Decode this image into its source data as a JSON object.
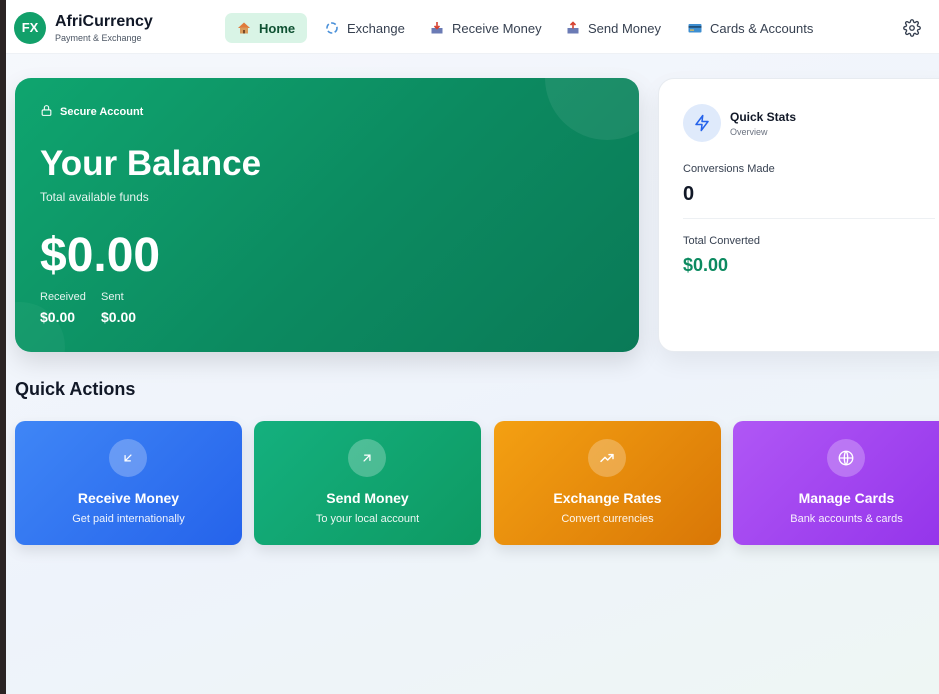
{
  "brand": {
    "logo": "FX",
    "name": "AfriCurrency",
    "tagline": "Payment & Exchange"
  },
  "nav": [
    {
      "label": "Home",
      "icon": "house-icon",
      "active": true
    },
    {
      "label": "Exchange",
      "icon": "exchange-icon",
      "active": false
    },
    {
      "label": "Receive Money",
      "icon": "receive-inbox-icon",
      "active": false
    },
    {
      "label": "Send Money",
      "icon": "send-outbox-icon",
      "active": false
    },
    {
      "label": "Cards & Accounts",
      "icon": "credit-card-icon",
      "active": false
    }
  ],
  "balance": {
    "badge": "Secure Account",
    "title": "Your Balance",
    "subtitle": "Total available funds",
    "amount": "$0.00",
    "received_label": "Received",
    "received_value": "$0.00",
    "sent_label": "Sent",
    "sent_value": "$0.00"
  },
  "quick_stats": {
    "title": "Quick Stats",
    "subtitle": "Overview",
    "conversions_label": "Conversions Made",
    "conversions_value": "0",
    "converted_label": "Total Converted",
    "converted_value": "$0.00"
  },
  "quick_actions": {
    "heading": "Quick Actions",
    "items": [
      {
        "title": "Receive Money",
        "subtitle": "Get paid internationally",
        "icon": "arrow-down-left-icon",
        "color": "#3b82f6"
      },
      {
        "title": "Send Money",
        "subtitle": "To your local account",
        "icon": "arrow-up-right-icon",
        "color": "#10b981"
      },
      {
        "title": "Exchange Rates",
        "subtitle": "Convert currencies",
        "icon": "trending-up-icon",
        "color": "#f59e0b"
      },
      {
        "title": "Manage Cards",
        "subtitle": "Bank accounts & cards",
        "icon": "globe-icon",
        "color": "#a855f7"
      }
    ]
  },
  "colors": {
    "accent": "#12a06a",
    "balance_card": "#0c8a60",
    "page_bg": "#f3f6fb"
  }
}
